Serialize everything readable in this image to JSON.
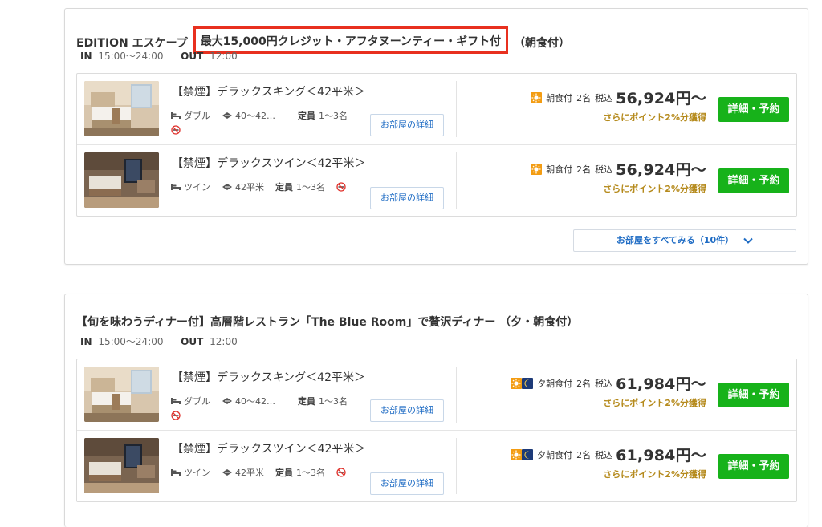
{
  "plans": [
    {
      "title_prefix": "EDITION エスケープ",
      "title_highlight": "最大15,000円クレジット・アフタヌーンティー・ギフト付",
      "title_suffix": "（朝食付）",
      "in_label": "IN",
      "in_time": "15:00〜24:00",
      "out_label": "OUT",
      "out_time": "12:00",
      "rooms": [
        {
          "name": "【禁煙】デラックスキング＜42平米＞",
          "bed": "ダブル",
          "size": "40〜42…",
          "capacity_label": "定員",
          "capacity": "1〜3名",
          "detail_label": "お部屋の詳細",
          "meal": "朝食付",
          "people": "2名",
          "tax": "税込",
          "price": "56,924円〜",
          "points": "さらにポイント2%分獲得",
          "reserve_label": "詳細・予約"
        },
        {
          "name": "【禁煙】デラックスツイン＜42平米＞",
          "bed": "ツイン",
          "size": "42平米",
          "capacity_label": "定員",
          "capacity": "1〜3名",
          "detail_label": "お部屋の詳細",
          "meal": "朝食付",
          "people": "2名",
          "tax": "税込",
          "price": "56,924円〜",
          "points": "さらにポイント2%分獲得",
          "reserve_label": "詳細・予約"
        }
      ],
      "see_all_label": "お部屋をすべてみる（10件）"
    },
    {
      "title": "【旬を味わうディナー付】高層階レストラン「The Blue Room」で贅沢ディナー （夕・朝食付）",
      "in_label": "IN",
      "in_time": "15:00〜24:00",
      "out_label": "OUT",
      "out_time": "12:00",
      "rooms": [
        {
          "name": "【禁煙】デラックスキング＜42平米＞",
          "bed": "ダブル",
          "size": "40〜42…",
          "capacity_label": "定員",
          "capacity": "1〜3名",
          "detail_label": "お部屋の詳細",
          "meal": "夕朝食付",
          "people": "2名",
          "tax": "税込",
          "price": "61,984円〜",
          "points": "さらにポイント2%分獲得",
          "reserve_label": "詳細・予約"
        },
        {
          "name": "【禁煙】デラックスツイン＜42平米＞",
          "bed": "ツイン",
          "size": "42平米",
          "capacity_label": "定員",
          "capacity": "1〜3名",
          "detail_label": "お部屋の詳細",
          "meal": "夕朝食付",
          "people": "2名",
          "tax": "税込",
          "price": "61,984円〜",
          "points": "さらにポイント2%分獲得",
          "reserve_label": "詳細・予約"
        }
      ]
    }
  ],
  "colors": {
    "reserve": "#17b21a",
    "link": "#1f6cc4",
    "points": "#b58a1c",
    "highlight": "#e8301f",
    "sun": "#f39c12",
    "moon": "#1d3a78"
  },
  "icons": {
    "bed": "bed-icon",
    "size": "room-size-icon",
    "no_smoking": "no-smoking-icon",
    "breakfast": "sun-icon",
    "dinner": "moon-icon",
    "chevron": "chevron-down-icon"
  }
}
